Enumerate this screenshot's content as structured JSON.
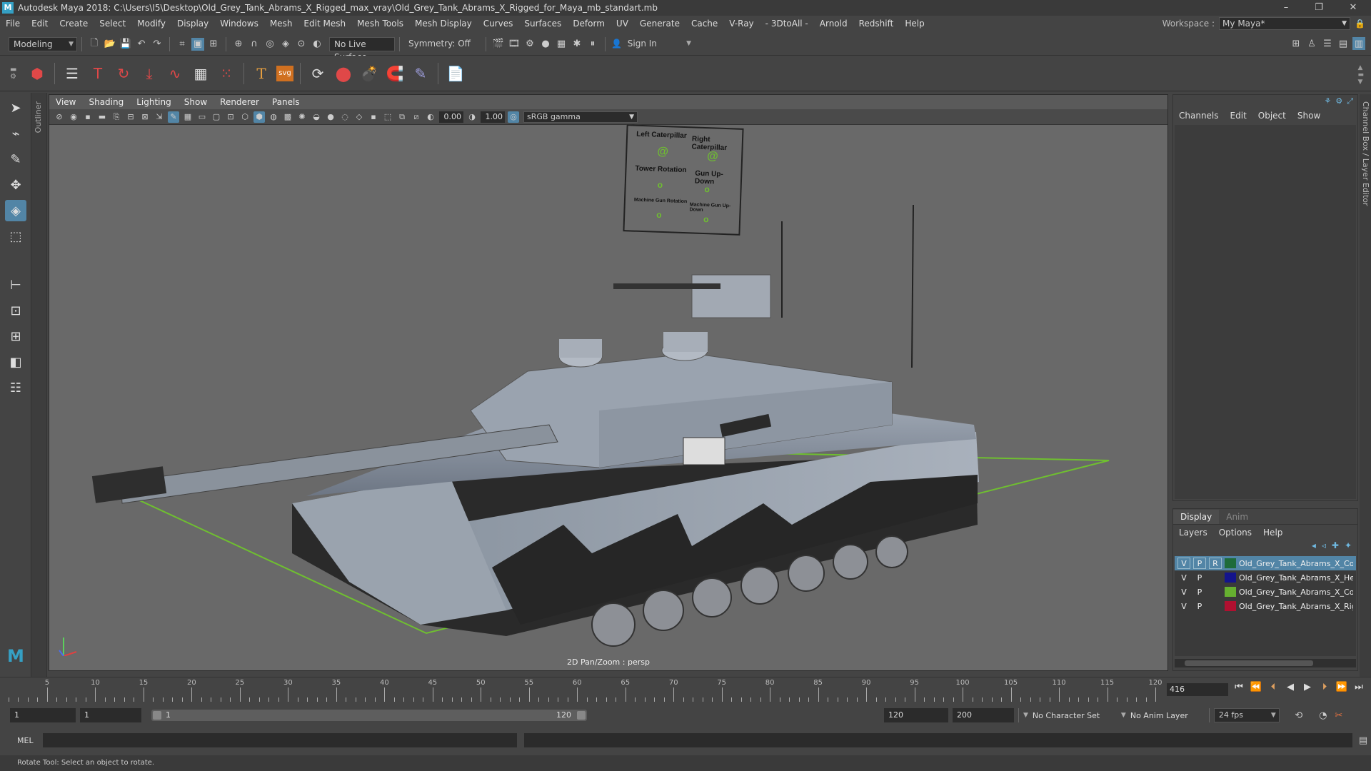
{
  "window": {
    "title": "Autodesk Maya 2018: C:\\Users\\I5\\Desktop\\Old_Grey_Tank_Abrams_X_Rigged_max_vray\\Old_Grey_Tank_Abrams_X_Rigged_for_Maya_mb_standart.mb",
    "logo": "M",
    "minimize": "–",
    "restore": "❐",
    "close": "✕"
  },
  "menu": [
    "File",
    "Edit",
    "Create",
    "Select",
    "Modify",
    "Display",
    "Windows",
    "Mesh",
    "Edit Mesh",
    "Mesh Tools",
    "Mesh Display",
    "Curves",
    "Surfaces",
    "Deform",
    "UV",
    "Generate",
    "Cache",
    "V-Ray",
    "- 3DtoAll -",
    "Arnold",
    "Redshift",
    "Help"
  ],
  "workspace": {
    "label": "Workspace :",
    "value": "My Maya*"
  },
  "status": {
    "mode": "Modeling",
    "live_surface": "No Live Surface",
    "symmetry": "Symmetry: Off",
    "sign_in": "Sign In"
  },
  "viewport": {
    "menu": [
      "View",
      "Shading",
      "Lighting",
      "Show",
      "Renderer",
      "Panels"
    ],
    "exposure": "0.00",
    "gamma": "1.00",
    "color_space": "sRGB gamma",
    "camera_label": "2D Pan/Zoom : persp",
    "rig_panel": {
      "left_caterpillar": "Left Caterpillar",
      "right_caterpillar": "Right Caterpillar",
      "tower_rotation": "Tower Rotation",
      "gun_updown": "Gun Up-Down",
      "mgun_rotation": "Machine Gun Rotation",
      "mgun_updown": "Machine Gun Up-Down"
    }
  },
  "side_tab": "Channel Box / Layer Editor",
  "outliner_tab": "Outliner",
  "channel_box": {
    "tabs": [
      "Channels",
      "Edit",
      "Object",
      "Show"
    ]
  },
  "layer_editor": {
    "tabs": [
      "Display",
      "Anim"
    ],
    "menu": [
      "Layers",
      "Options",
      "Help"
    ],
    "layers": [
      {
        "v": "V",
        "p": "P",
        "r": "R",
        "color": "#1e6b3a",
        "name": "Old_Grey_Tank_Abrams_X_Controllers"
      },
      {
        "v": "V",
        "p": "P",
        "r": "",
        "color": "#14148c",
        "name": "Old_Grey_Tank_Abrams_X_Helpers"
      },
      {
        "v": "V",
        "p": "P",
        "r": "",
        "color": "#66b030",
        "name": "Old_Grey_Tank_Abrams_X_Controllers"
      },
      {
        "v": "V",
        "p": "P",
        "r": "",
        "color": "#b01030",
        "name": "Old_Grey_Tank_Abrams_X_Rigged"
      }
    ]
  },
  "timeline": {
    "labels": [
      "5",
      "10",
      "15",
      "20",
      "25",
      "30",
      "35",
      "40",
      "45",
      "50",
      "55",
      "60",
      "65",
      "70",
      "75",
      "80",
      "85",
      "90",
      "95",
      "100",
      "105",
      "110",
      "115",
      "120"
    ],
    "current_frame": "416"
  },
  "range": {
    "start": "1",
    "playback_start": "1",
    "slider_start": "1",
    "slider_end": "120",
    "playback_end": "120",
    "end": "200",
    "character_set": "No Character Set",
    "anim_layer": "No Anim Layer",
    "fps": "24 fps"
  },
  "cmd": {
    "label": "MEL"
  },
  "help_line": "Rotate Tool: Select an object to rotate."
}
